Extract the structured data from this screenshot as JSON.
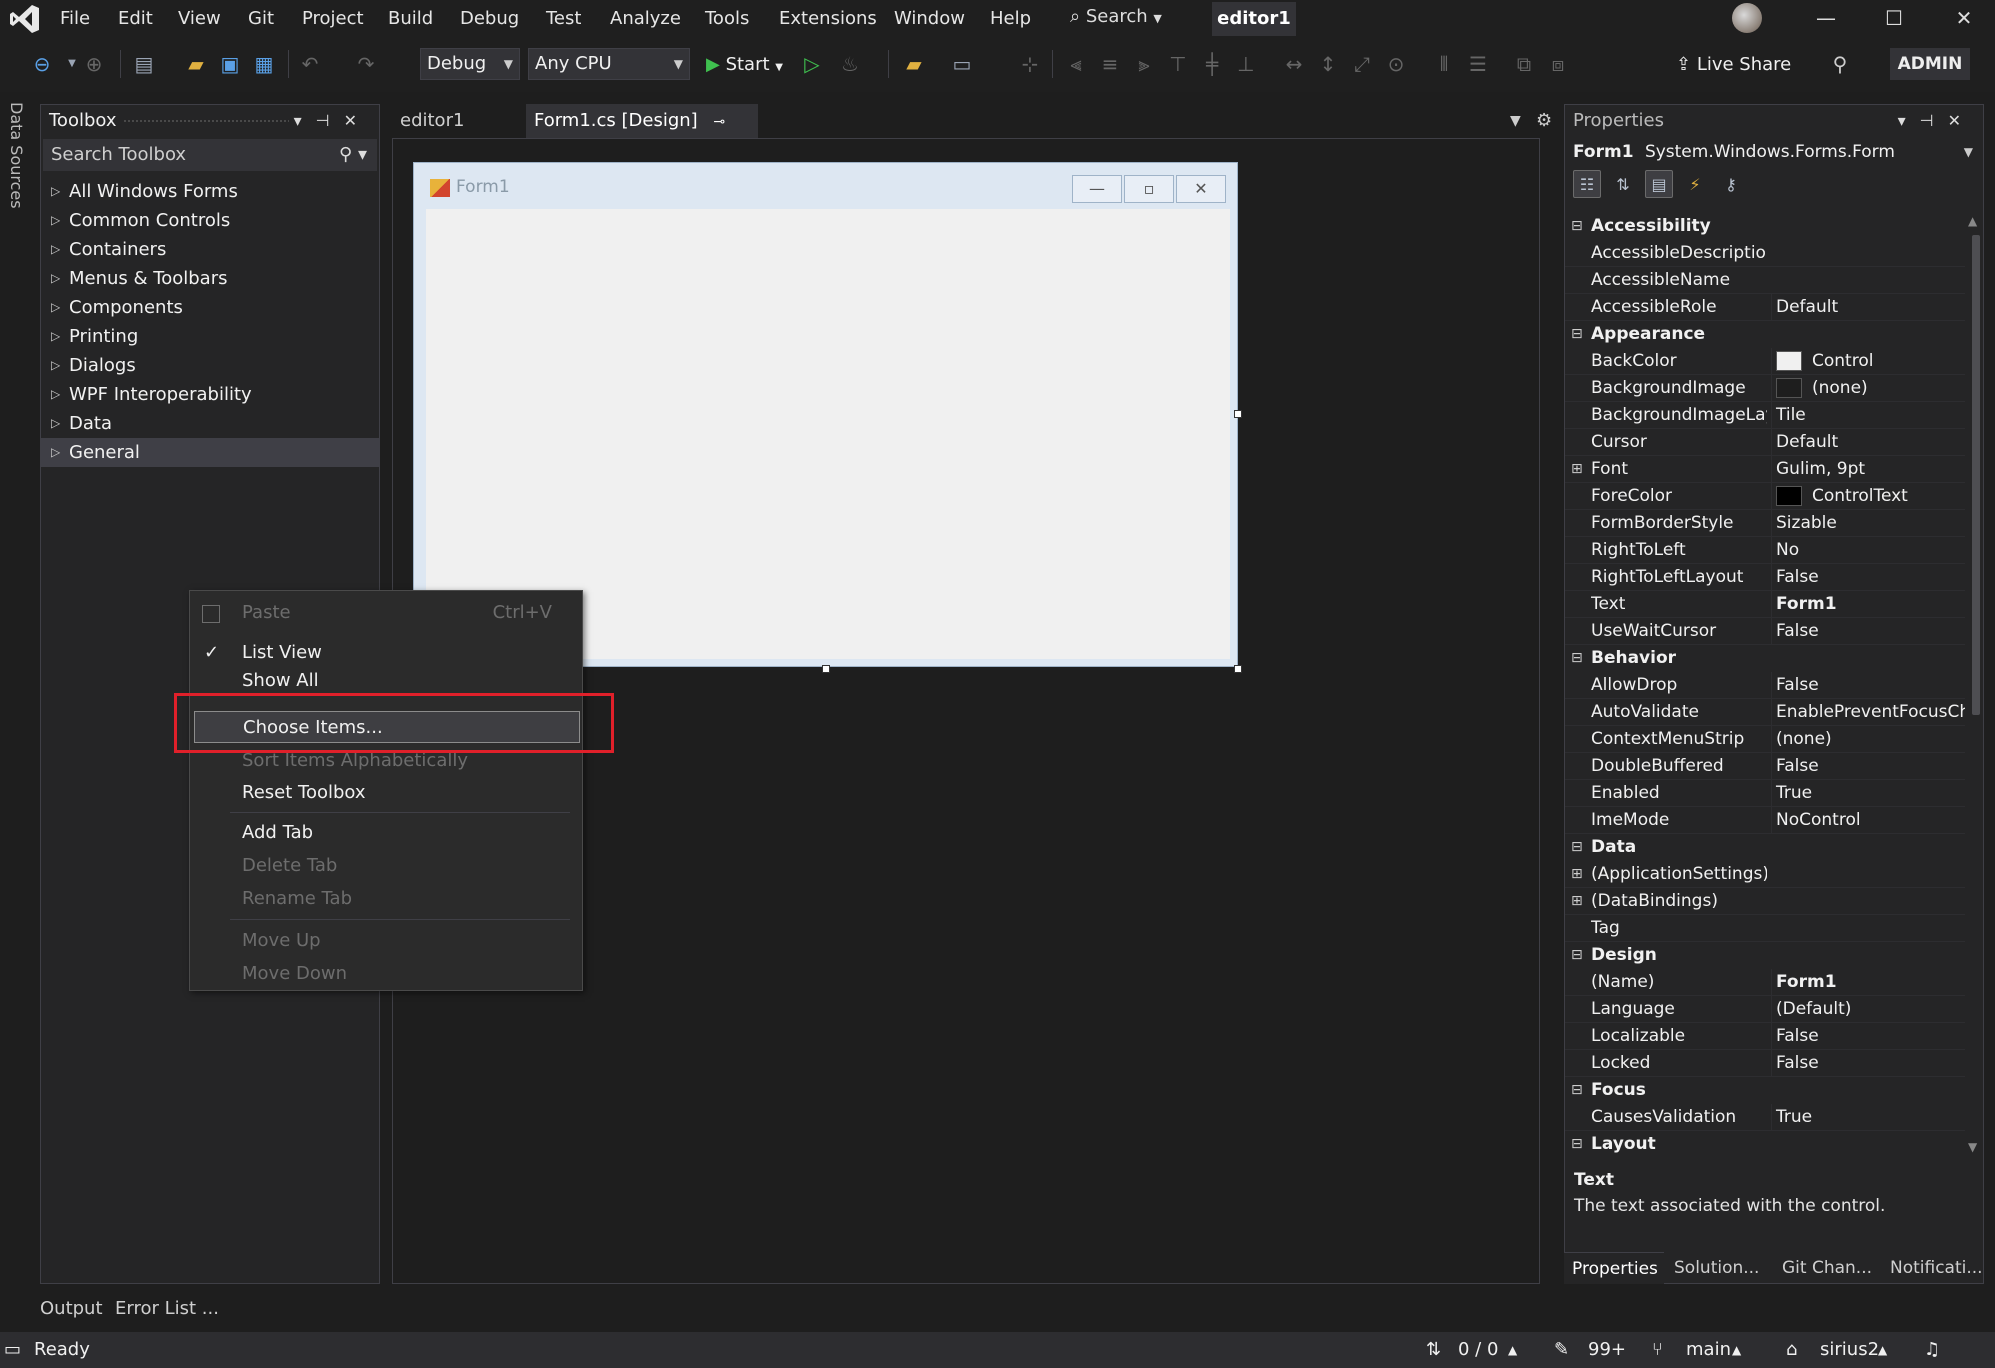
{
  "menu": [
    "File",
    "Edit",
    "View",
    "Git",
    "Project",
    "Build",
    "Debug",
    "Test",
    "Analyze",
    "Tools",
    "Extensions",
    "Window",
    "Help"
  ],
  "search_label": "Search",
  "solution_title": "editor1",
  "toolbar": {
    "config": "Debug",
    "platform": "Any CPU",
    "start_label": "Start",
    "live_share_label": "Live Share",
    "admin_label": "ADMIN"
  },
  "data_sources_label": "Data Sources",
  "toolbox": {
    "title": "Toolbox",
    "search_placeholder": "Search Toolbox",
    "items": [
      "All Windows Forms",
      "Common Controls",
      "Containers",
      "Menus & Toolbars",
      "Components",
      "Printing",
      "Dialogs",
      "WPF Interoperability",
      "Data",
      "General"
    ]
  },
  "doc_tabs": [
    "editor1",
    "Form1.cs [Design]"
  ],
  "form": {
    "title": "Form1"
  },
  "context_menu": {
    "paste": "Paste",
    "paste_shortcut": "Ctrl+V",
    "list_view": "List View",
    "show_all": "Show All",
    "choose_items": "Choose Items...",
    "sort": "Sort Items Alphabetically",
    "reset": "Reset Toolbox",
    "add_tab": "Add Tab",
    "delete_tab": "Delete Tab",
    "rename_tab": "Rename Tab",
    "move_up": "Move Up",
    "move_down": "Move Down"
  },
  "properties": {
    "title": "Properties",
    "object_name": "Form1",
    "object_type": "System.Windows.Forms.Form",
    "categories": [
      {
        "name": "Accessibility",
        "rows": [
          {
            "name": "AccessibleDescription",
            "value": ""
          },
          {
            "name": "AccessibleName",
            "value": ""
          },
          {
            "name": "AccessibleRole",
            "value": "Default"
          }
        ]
      },
      {
        "name": "Appearance",
        "rows": [
          {
            "name": "BackColor",
            "value": "Control",
            "swatch": "#f0f0f0"
          },
          {
            "name": "BackgroundImage",
            "value": "(none)",
            "swatch": "#1e1e1e"
          },
          {
            "name": "BackgroundImageLayout",
            "value": "Tile"
          },
          {
            "name": "Cursor",
            "value": "Default"
          },
          {
            "name": "Font",
            "value": "Gulim, 9pt",
            "expand": true
          },
          {
            "name": "ForeColor",
            "value": "ControlText",
            "swatch": "#000000"
          },
          {
            "name": "FormBorderStyle",
            "value": "Sizable"
          },
          {
            "name": "RightToLeft",
            "value": "No"
          },
          {
            "name": "RightToLeftLayout",
            "value": "False"
          },
          {
            "name": "Text",
            "value": "Form1",
            "bold": true
          },
          {
            "name": "UseWaitCursor",
            "value": "False"
          }
        ]
      },
      {
        "name": "Behavior",
        "rows": [
          {
            "name": "AllowDrop",
            "value": "False"
          },
          {
            "name": "AutoValidate",
            "value": "EnablePreventFocusChange"
          },
          {
            "name": "ContextMenuStrip",
            "value": "(none)"
          },
          {
            "name": "DoubleBuffered",
            "value": "False"
          },
          {
            "name": "Enabled",
            "value": "True"
          },
          {
            "name": "ImeMode",
            "value": "NoControl"
          }
        ]
      },
      {
        "name": "Data",
        "rows": [
          {
            "name": "(ApplicationSettings)",
            "value": "",
            "expand": true
          },
          {
            "name": "(DataBindings)",
            "value": "",
            "expand": true
          },
          {
            "name": "Tag",
            "value": ""
          }
        ]
      },
      {
        "name": "Design",
        "rows": [
          {
            "name": "(Name)",
            "value": "Form1",
            "bold": true
          },
          {
            "name": "Language",
            "value": "(Default)"
          },
          {
            "name": "Localizable",
            "value": "False"
          },
          {
            "name": "Locked",
            "value": "False"
          }
        ]
      },
      {
        "name": "Focus",
        "rows": [
          {
            "name": "CausesValidation",
            "value": "True"
          }
        ]
      },
      {
        "name": "Layout",
        "rows": []
      }
    ],
    "description_title": "Text",
    "description_text": "The text associated with the control.",
    "tabs": [
      "Properties",
      "Solution...",
      "Git Chan...",
      "Notificati..."
    ]
  },
  "bottom_tabs": [
    "Output",
    "Error List ..."
  ],
  "status": {
    "ready": "Ready",
    "sync": "0 / 0",
    "edits": "99+",
    "branch": "main",
    "repo": "sirius2"
  },
  "colors": {
    "highlight": "#e0202a",
    "accent": "#007acc"
  }
}
